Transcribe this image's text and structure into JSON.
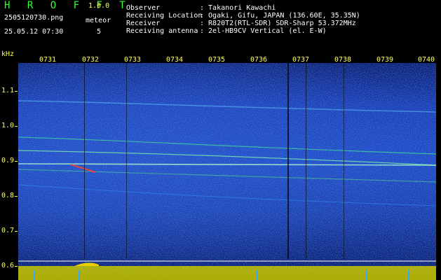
{
  "header": {
    "title": "H R O F F T",
    "version": "1.0.0",
    "filename": "2505120730.png",
    "meteor_label": "meteor",
    "datetime": "25.05.12 07:30",
    "meteor_count": "5"
  },
  "info": [
    {
      "label": "Observer",
      "value": ": Takanori Kawachi"
    },
    {
      "label": "Receiving Location",
      "value": ": Ogaki, Gifu, JAPAN (136.60E, 35.35N)"
    },
    {
      "label": "Receiver",
      "value": ": R820T2(RTL-SDR) SDR-Sharp 53.372MHz"
    },
    {
      "label": "Receiving antenna",
      "value": ": 2el-HB9CV Vertical (el. E-W)"
    }
  ],
  "axis": {
    "y_unit": "kHz",
    "y_ticks": [
      "1.1",
      "1.0",
      "0.9",
      "0.8",
      "0.7",
      "0.6"
    ],
    "x_ticks": [
      "0731",
      "0732",
      "0733",
      "0734",
      "0735",
      "0736",
      "0737",
      "0738",
      "0739",
      "0740"
    ]
  },
  "colors": {
    "title": "#33ff33",
    "axis": "#ffff55",
    "text": "#ffffff",
    "background": "#000000",
    "spectrogram_base": "#1f49c6"
  }
}
